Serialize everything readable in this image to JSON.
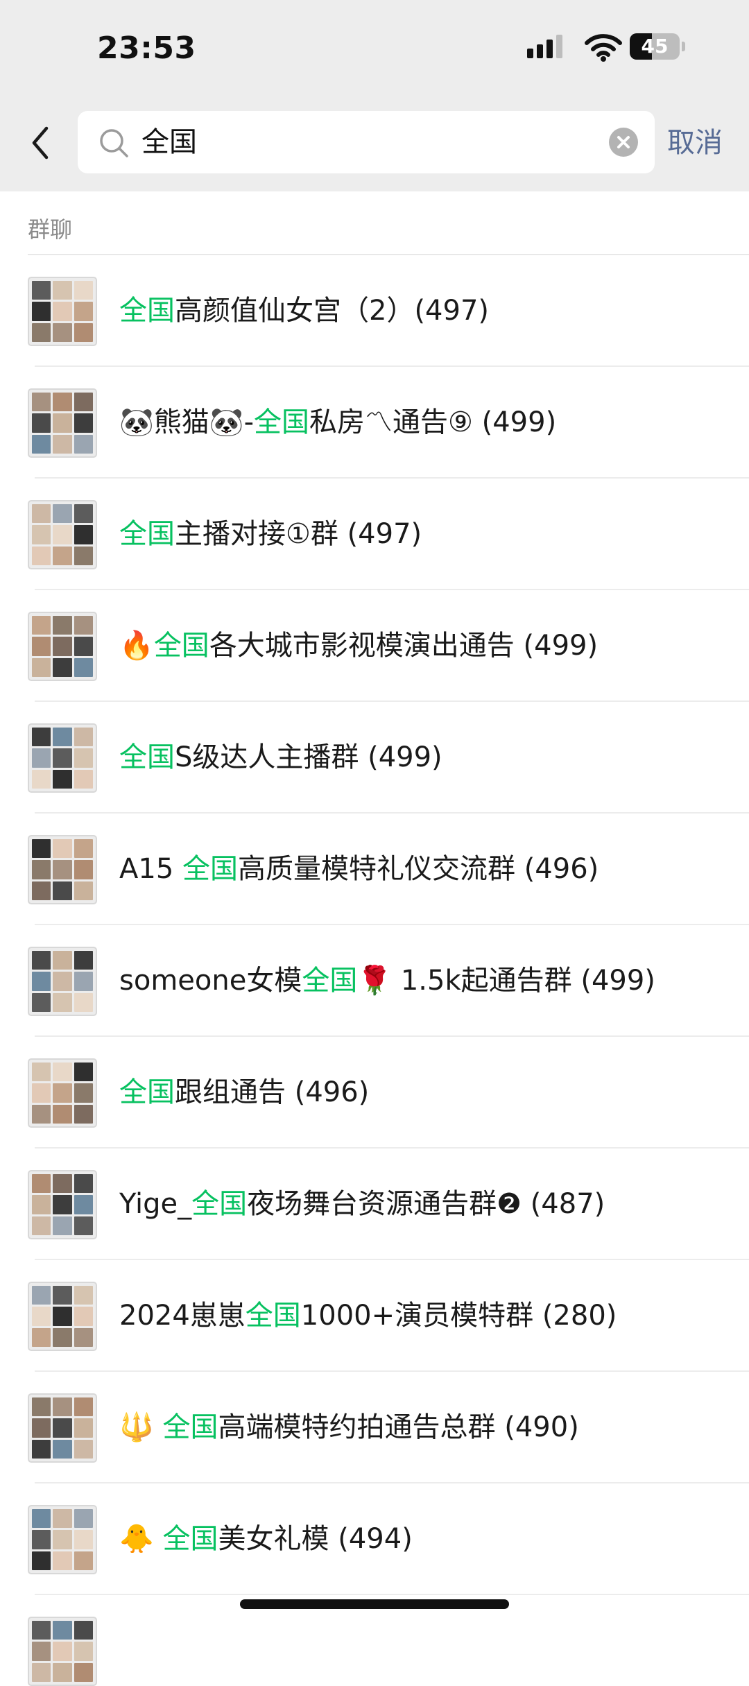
{
  "status_bar": {
    "time": "23:53",
    "battery_percent": "45",
    "battery_level": 0.45
  },
  "header": {
    "back_icon": "chevron-left-icon",
    "search": {
      "value": "全国",
      "placeholder": "",
      "search_icon": "search-icon",
      "clear_icon": "clear-circle-icon"
    },
    "cancel_label": "取消"
  },
  "section": {
    "label": "群聊"
  },
  "colors": {
    "highlight": "#07c160",
    "cancel": "#576b95",
    "header_bg": "#ededed"
  },
  "results": [
    {
      "pre": "",
      "hl": "全国",
      "post": "高颜值仙女宫（2）(497)"
    },
    {
      "pre": "🐼熊猫🐼-",
      "hl": "全国",
      "post": "私房〽通告⑨ (499)"
    },
    {
      "pre": "",
      "hl": "全国",
      "post": "主播对接①群 (497)"
    },
    {
      "pre": "🔥",
      "hl": "全国",
      "post": "各大城市影视模演出通告 (499)"
    },
    {
      "pre": "",
      "hl": "全国",
      "post": "S级达人主播群 (499)"
    },
    {
      "pre": "A15 ",
      "hl": "全国",
      "post": "高质量模特礼仪交流群 (496)"
    },
    {
      "pre": "someone女模",
      "hl": "全国",
      "post": "🌹 1.5k起通告群 (499)"
    },
    {
      "pre": "",
      "hl": "全国",
      "post": "跟组通告 (496)"
    },
    {
      "pre": "Yige_",
      "hl": "全国",
      "post": "夜场舞台资源通告群❷ (487)"
    },
    {
      "pre": "2024崽崽",
      "hl": "全国",
      "post": "1000+演员模特群 (280)"
    },
    {
      "pre": "🔱 ",
      "hl": "全国",
      "post": "高端模特约拍通告总群 (490)"
    },
    {
      "pre": "🐥 ",
      "hl": "全国",
      "post": "美女礼模 (494)"
    }
  ]
}
